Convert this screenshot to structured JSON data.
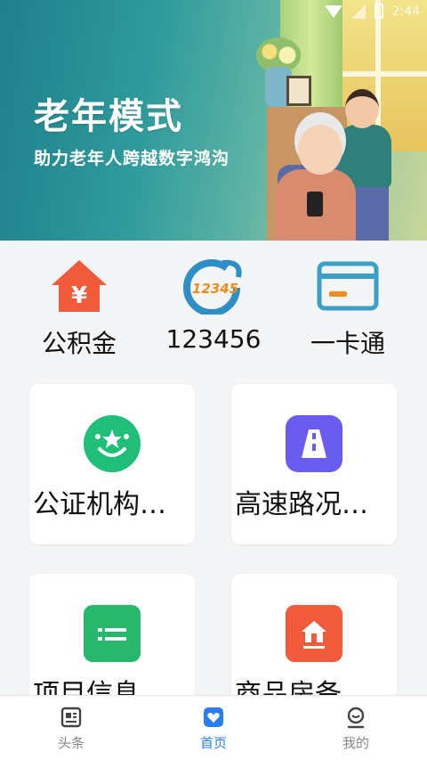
{
  "status_bar": {
    "time": "2:44"
  },
  "banner": {
    "title": "老年模式",
    "subtitle": "助力老年人跨越数字鸿沟"
  },
  "quick_links": [
    {
      "label": "公积金",
      "icon": "house-yen-icon"
    },
    {
      "label": "123456",
      "icon": "hotline-12345-icon"
    },
    {
      "label": "一卡通",
      "icon": "card-icon"
    }
  ],
  "cards": [
    {
      "label": "公证机构信…",
      "icon": "smile-badge-icon",
      "color": "#1fbf7a"
    },
    {
      "label": "高速路况查…",
      "icon": "highway-icon",
      "color": "#6b5cf0"
    },
    {
      "label": "项目信息查…",
      "icon": "folder-list-icon",
      "color": "#27b86d"
    },
    {
      "label": "商品房备案…",
      "icon": "house-doc-icon",
      "color": "#f15a3a"
    }
  ],
  "tabs": [
    {
      "label": "头条",
      "icon": "newspaper-icon"
    },
    {
      "label": "首页",
      "icon": "heart-box-icon",
      "active": true
    },
    {
      "label": "我的",
      "icon": "person-icon"
    }
  ],
  "colors": {
    "accent": "#2a7ff0",
    "orange": "#f15a3a",
    "teal": "#2f9b9c"
  }
}
